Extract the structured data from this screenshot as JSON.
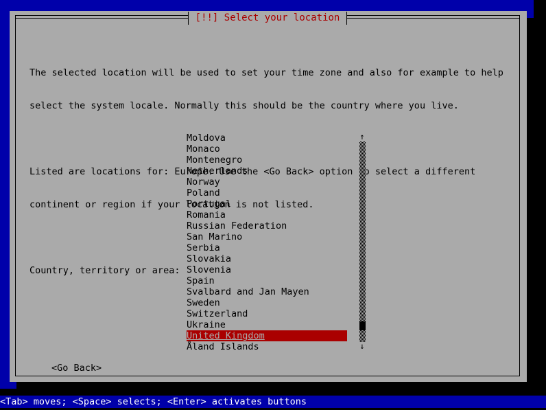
{
  "colors": {
    "background_blue": "#0000aa",
    "dialog_gray": "#aaaaaa",
    "title_red": "#aa0000",
    "highlight_red": "#aa0000",
    "text_black": "#000000",
    "status_text": "#ffffff",
    "shadow_black": "#000000"
  },
  "dialog": {
    "title": "[!!] Select your location",
    "paragraphs": [
      [
        "The selected location will be used to set your time zone and also for example to help",
        "select the system locale. Normally this should be the country where you live."
      ],
      [
        "Listed are locations for: Europe. Use the <Go Back> option to select a different",
        "continent or region if your location is not listed."
      ],
      [
        "Country, territory or area:"
      ]
    ],
    "list": {
      "label": "Country, territory or area:",
      "selected_index": 18,
      "items": [
        "Moldova",
        "Monaco",
        "Montenegro",
        "Netherlands",
        "Norway",
        "Poland",
        "Portugal",
        "Romania",
        "Russian Federation",
        "San Marino",
        "Serbia",
        "Slovakia",
        "Slovenia",
        "Spain",
        "Svalbard and Jan Mayen",
        "Sweden",
        "Switzerland",
        "Ukraine",
        "United Kingdom",
        "Åland Islands"
      ]
    },
    "scrollbar": {
      "up_arrow": "↑",
      "down_arrow": "↓"
    },
    "buttons": {
      "go_back": "<Go Back>"
    }
  },
  "status_bar": {
    "text": "<Tab> moves; <Space> selects; <Enter> activates buttons"
  }
}
